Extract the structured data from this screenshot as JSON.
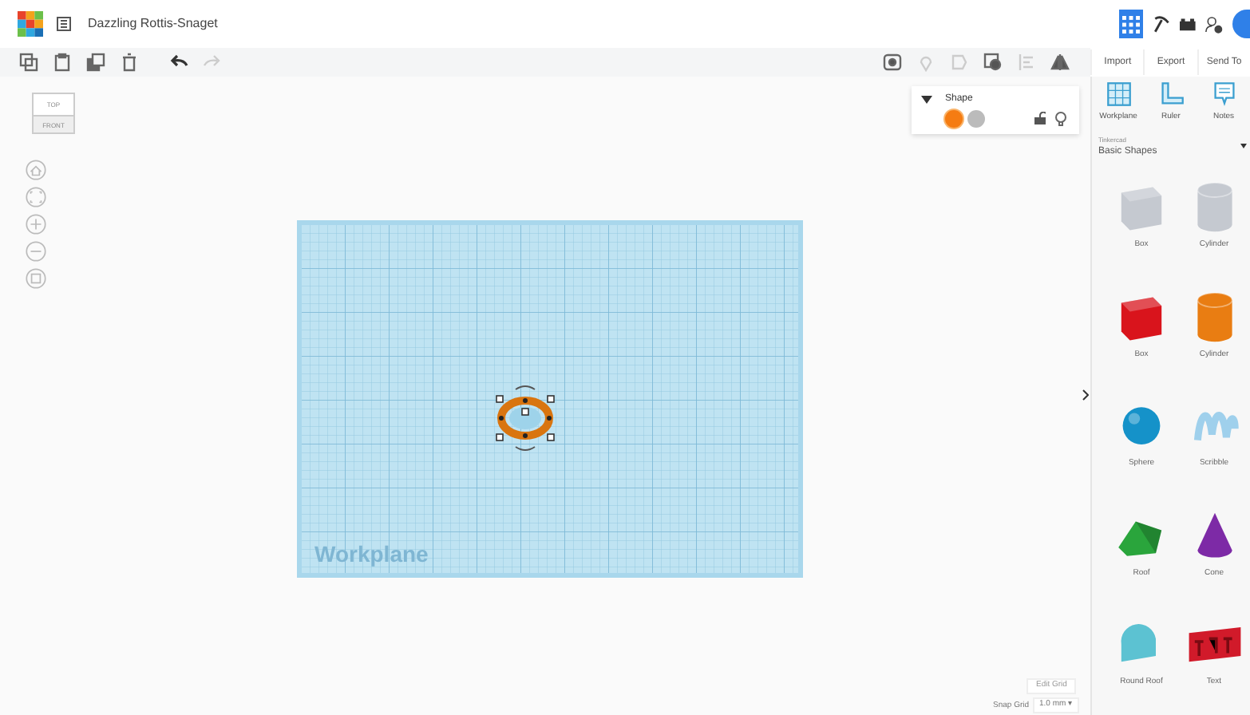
{
  "window": {
    "title": "Dazzling Rottis-Snaget"
  },
  "view_cube": {
    "top": "TOP",
    "front": "FRONT"
  },
  "shape_panel": {
    "title": "Shape",
    "expanded": true,
    "solid_selected": true,
    "locked": false
  },
  "top_actions": [
    {
      "label": "Import"
    },
    {
      "label": "Export"
    },
    {
      "label": "Send To"
    }
  ],
  "tools": [
    {
      "label": "Workplane",
      "kind": "workplane"
    },
    {
      "label": "Ruler",
      "kind": "ruler"
    },
    {
      "label": "Notes",
      "kind": "notes"
    }
  ],
  "library": {
    "label": "Tinkercad",
    "value": "Basic Shapes"
  },
  "shapes": [
    {
      "label": "Box",
      "kind": "box",
      "color": "#c5c9d0"
    },
    {
      "label": "Cylinder",
      "kind": "cylinder",
      "color": "#c5c9d0"
    },
    {
      "label": "Box",
      "kind": "box",
      "color": "#d9141c"
    },
    {
      "label": "Cylinder",
      "kind": "cylinder",
      "color": "#e97d12"
    },
    {
      "label": "Sphere",
      "kind": "sphere",
      "color": "#1592c9"
    },
    {
      "label": "Scribble",
      "kind": "scribble",
      "color": "#9fd0ec"
    },
    {
      "label": "Roof",
      "kind": "roof",
      "color": "#2aa53c"
    },
    {
      "label": "Cone",
      "kind": "cone",
      "color": "#7d2aa6"
    },
    {
      "label": "Round Roof",
      "kind": "roundroof",
      "color": "#5cc2d2"
    },
    {
      "label": "Text",
      "kind": "text",
      "color": "#d11a2a"
    }
  ],
  "workplane": {
    "label": "Workplane"
  },
  "grid": {
    "edit": "Edit Grid",
    "snap_label": "Snap Grid",
    "snap_value": "1.0 mm ▾"
  }
}
